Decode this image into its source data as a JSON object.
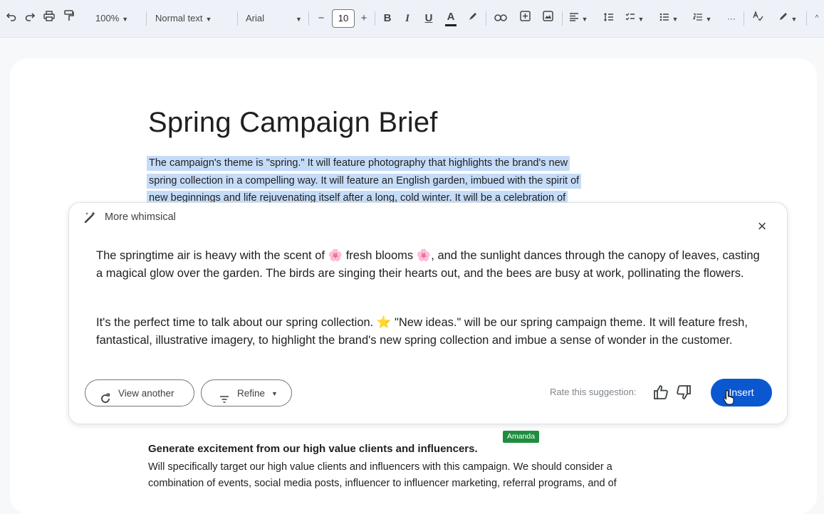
{
  "toolbar": {
    "zoom": "100%",
    "style": "Normal text",
    "font": "Arial",
    "font_size": "10",
    "minus": "−",
    "plus": "+",
    "bold": "B",
    "italic": "I",
    "underline": "U",
    "text_color": "A",
    "more": "···"
  },
  "document": {
    "title": "Spring Campaign Brief",
    "selected_lines": [
      "The campaign's theme is \"spring.\" It will feature photography that highlights the brand's new",
      "spring collection in a compelling way. It will feature an English garden, imbued with the spirit of",
      "new beginnings and life rejuvenating itself after a long, cold winter. It will be a celebration of"
    ],
    "collaborator": "Amanda",
    "section_heading": "Generate excitement from our high value clients and influencers.",
    "body_lines": [
      "Will specifically target our high value clients and influencers with this campaign. We should consider a",
      "combination of events, social media posts, influencer to influencer marketing, referral programs, and of"
    ]
  },
  "suggestion": {
    "label": "More whimsical",
    "paragraph1": {
      "a": "The springtime air is heavy with the scent of ",
      "emoji1": "🌸",
      "b": " fresh blooms ",
      "emoji2": "🌸",
      "c": ", and the sunlight dances through the canopy of leaves, casting a magical glow over the garden. The birds are singing their hearts out, and the bees are busy at work, pollinating the flowers."
    },
    "paragraph2": {
      "a": "It's the perfect time to talk about our spring collection. ",
      "emoji": "⭐",
      "b": " \"New ideas.\" will be our spring campaign theme. It will feature fresh, fantastical, illustrative imagery, to highlight the brand's new spring collection and imbue a sense of wonder in the customer."
    },
    "view_another_label": "View another",
    "refine_label": "Refine",
    "rate_label": "Rate this suggestion:",
    "insert_label": "Insert"
  },
  "colors": {
    "accent": "#0b57d0",
    "selection": "#c5dcf8",
    "collaborator": "#1e8e3e"
  }
}
